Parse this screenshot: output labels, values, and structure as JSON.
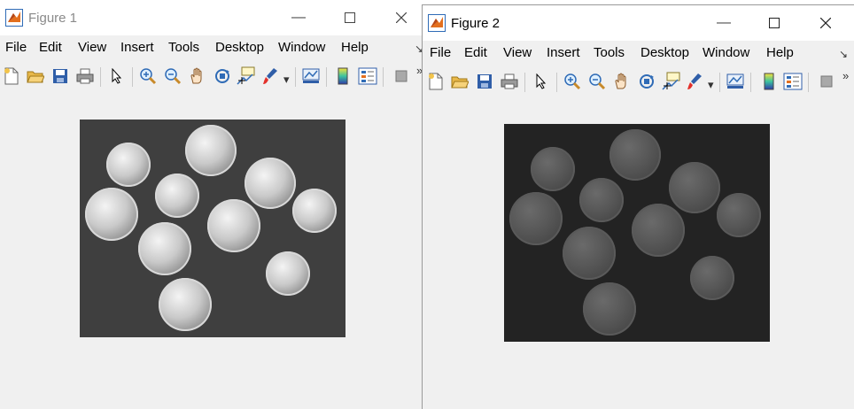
{
  "windows": [
    {
      "title": "Figure 1",
      "menu": [
        "File",
        "Edit",
        "View",
        "Insert",
        "Tools",
        "Desktop",
        "Window",
        "Help"
      ],
      "image": "coins-original"
    },
    {
      "title": "Figure 2",
      "menu": [
        "File",
        "Edit",
        "View",
        "Insert",
        "Tools",
        "Desktop",
        "Window",
        "Help"
      ],
      "image": "coins-darkened"
    }
  ],
  "toolbar_icons": [
    "new-figure-icon",
    "open-file-icon",
    "save-icon",
    "print-icon",
    "edit-plot-arrow-icon",
    "zoom-in-icon",
    "zoom-out-icon",
    "pan-hand-icon",
    "rotate-3d-icon",
    "data-cursor-icon",
    "brush-icon",
    "link-plot-icon",
    "colorbar-icon",
    "legend-icon",
    "hide-plot-tools-icon"
  ],
  "colors": {
    "matlab_orange": "#e36f1e",
    "matlab_blue": "#2f6bb6",
    "background": "#f0f0f0"
  }
}
